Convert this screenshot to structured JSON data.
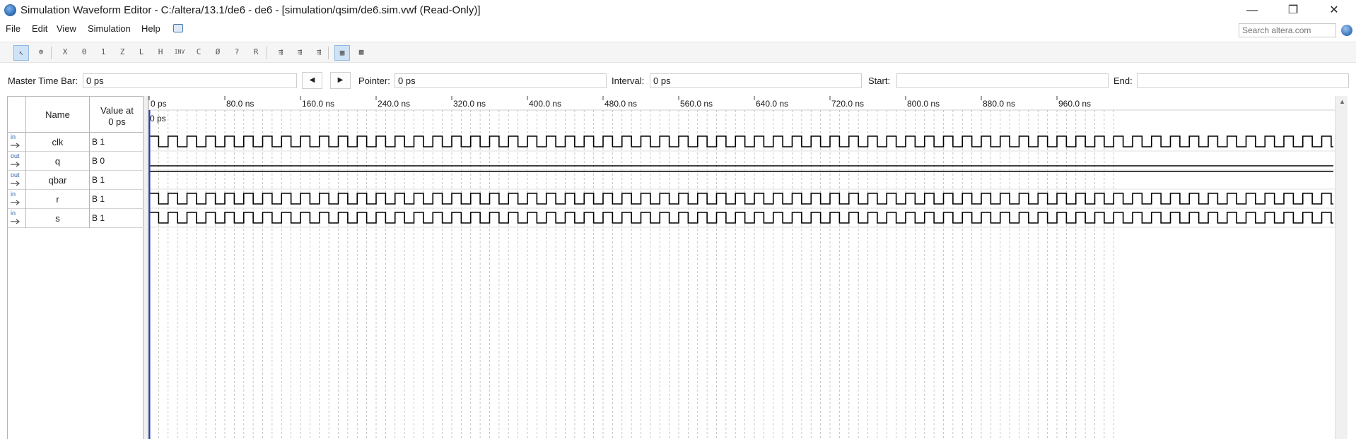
{
  "window": {
    "title": "Simulation Waveform Editor - C:/altera/13.1/de6 - de6 - [simulation/qsim/de6.sim.vwf (Read-Only)]",
    "minimize": "—",
    "maximize": "❐",
    "close": "✕"
  },
  "menu": {
    "file": "File",
    "edit": "Edit",
    "view": "View",
    "simulation": "Simulation",
    "help": "Help",
    "search_placeholder": "Search altera.com"
  },
  "toolbar": {
    "tools": [
      {
        "name": "selection-tool-icon",
        "glyph": "↖"
      },
      {
        "name": "zoom-tool-icon",
        "glyph": "⊕"
      },
      {
        "name": "force-unknown-icon",
        "glyph": "X"
      },
      {
        "name": "force-low-icon",
        "glyph": "0"
      },
      {
        "name": "force-high-icon",
        "glyph": "1"
      },
      {
        "name": "force-high-impedance-icon",
        "glyph": "Z"
      },
      {
        "name": "force-weak-low-icon",
        "glyph": "L"
      },
      {
        "name": "force-weak-high-icon",
        "glyph": "H"
      },
      {
        "name": "invert-icon",
        "glyph": "INV"
      },
      {
        "name": "count-value-icon",
        "glyph": "C"
      },
      {
        "name": "overwrite-clock-icon",
        "glyph": "Ø"
      },
      {
        "name": "arbitrary-value-icon",
        "glyph": "?"
      },
      {
        "name": "random-value-icon",
        "glyph": "R"
      },
      {
        "name": "functional-simulation-icon",
        "glyph": "⇶"
      },
      {
        "name": "timing-simulation-icon",
        "glyph": "⇶"
      },
      {
        "name": "netlist-icon",
        "glyph": "⇶"
      },
      {
        "name": "snap-to-grid-icon",
        "glyph": "▦"
      },
      {
        "name": "grid-settings-icon",
        "glyph": "▩"
      }
    ]
  },
  "timebar": {
    "master_label": "Master Time Bar:",
    "master_value": "0 ps",
    "prev": "◀",
    "next": "▶",
    "pointer_label": "Pointer:",
    "pointer_value": "0 ps",
    "interval_label": "Interval:",
    "interval_value": "0 ps",
    "start_label": "Start:",
    "start_value": "",
    "end_label": "End:",
    "end_value": ""
  },
  "signals_header": {
    "name": "Name",
    "value_line1": "Value at",
    "value_line2": "0 ps"
  },
  "signals": [
    {
      "dir": "in",
      "name": "clk",
      "value": "B 1",
      "kind": "clock"
    },
    {
      "dir": "out",
      "name": "q",
      "value": "B 0",
      "kind": "low"
    },
    {
      "dir": "out",
      "name": "qbar",
      "value": "B 1",
      "kind": "high"
    },
    {
      "dir": "in",
      "name": "r",
      "value": "B 1",
      "kind": "clock"
    },
    {
      "dir": "in",
      "name": "s",
      "value": "B 1",
      "kind": "clock"
    }
  ],
  "timeline": {
    "tick_labels": [
      "0 ps",
      "80.0 ns",
      "160.0 ns",
      "240.0 ns",
      "320.0 ns",
      "400.0 ns",
      "480.0 ns",
      "560.0 ns",
      "640.0 ns",
      "720.0 ns",
      "800.0 ns",
      "880.0 ns",
      "960.0 ns"
    ],
    "cursor_label": "0 ps",
    "range_ns": [
      0,
      1000
    ],
    "clock_period_ns": 20
  },
  "colors": {
    "cursor": "#1f3fd0",
    "grid": "#b8b8b8",
    "wave": "#000000"
  }
}
